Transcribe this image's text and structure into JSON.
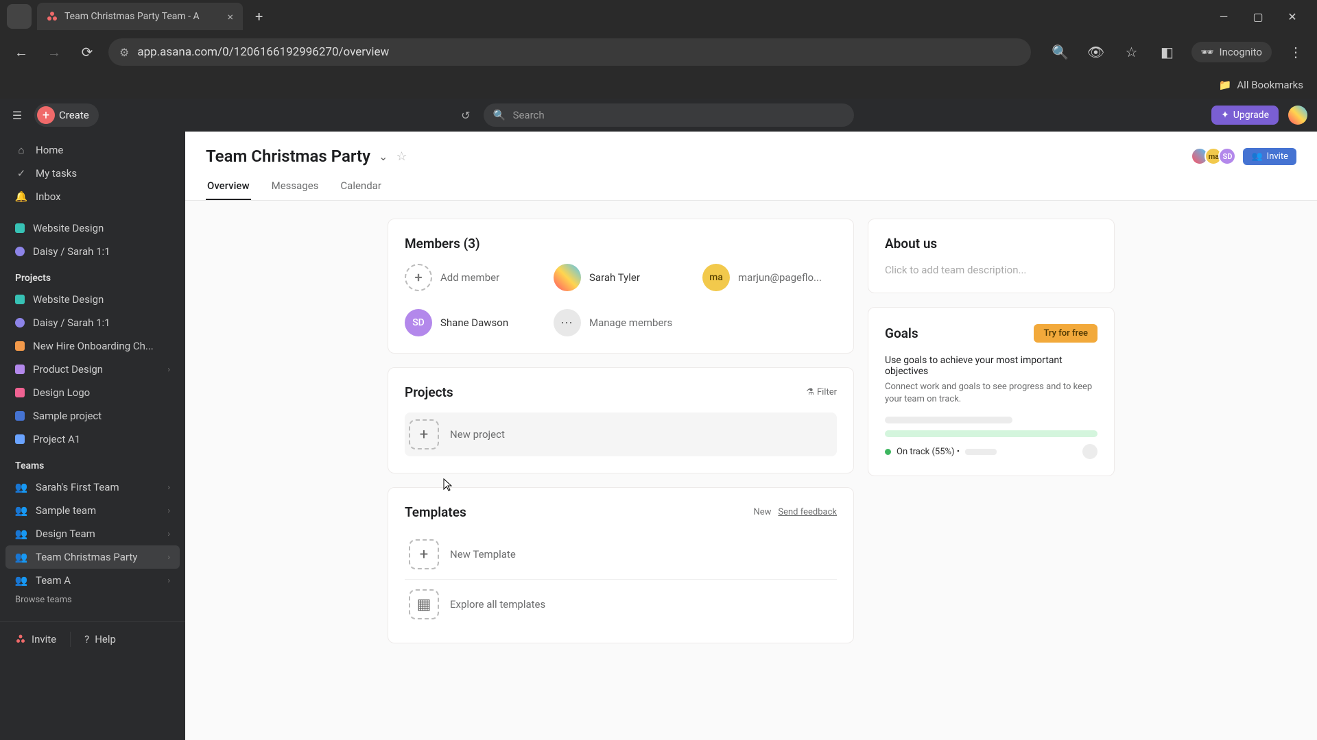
{
  "browser": {
    "tab_title": "Team Christmas Party Team - A",
    "url": "app.asana.com/0/1206166192996270/overview",
    "incognito_label": "Incognito",
    "bookmarks_label": "All Bookmarks"
  },
  "topbar": {
    "create_label": "Create",
    "search_placeholder": "Search",
    "upgrade_label": "Upgrade"
  },
  "sidebar": {
    "nav": [
      {
        "icon": "home",
        "label": "Home"
      },
      {
        "icon": "check",
        "label": "My tasks"
      },
      {
        "icon": "bell",
        "label": "Inbox"
      }
    ],
    "recent": [
      {
        "color": "c-teal",
        "label": "Website Design",
        "shape": "square"
      },
      {
        "color": "c-purple",
        "label": "Daisy / Sarah 1:1",
        "shape": "circle"
      }
    ],
    "projects_label": "Projects",
    "projects": [
      {
        "color": "c-teal",
        "label": "Website Design",
        "shape": "square",
        "chev": false
      },
      {
        "color": "c-purple",
        "label": "Daisy / Sarah 1:1",
        "shape": "circle",
        "chev": false
      },
      {
        "color": "c-orange",
        "label": "New Hire Onboarding Ch...",
        "shape": "square",
        "chev": false
      },
      {
        "color": "c-lav",
        "label": "Product Design",
        "shape": "square",
        "chev": true
      },
      {
        "color": "c-pink",
        "label": "Design Logo",
        "shape": "square",
        "chev": false
      },
      {
        "color": "c-darkblue",
        "label": "Sample project",
        "shape": "square",
        "chev": false
      },
      {
        "color": "c-blue",
        "label": "Project A1",
        "shape": "square",
        "chev": false
      }
    ],
    "teams_label": "Teams",
    "teams": [
      {
        "label": "Sarah's First Team",
        "active": false
      },
      {
        "label": "Sample team",
        "active": false
      },
      {
        "label": "Design Team",
        "active": false
      },
      {
        "label": "Team Christmas Party",
        "active": true
      },
      {
        "label": "Team A",
        "active": false
      }
    ],
    "browse_teams": "Browse teams",
    "invite_label": "Invite",
    "help_label": "Help"
  },
  "header": {
    "title": "Team Christmas Party",
    "tabs": [
      "Overview",
      "Messages",
      "Calendar"
    ],
    "active_tab": "Overview",
    "invite_label": "Invite",
    "avatars": [
      {
        "bg": "linear-gradient(45deg,#ff5263,#4fc3f7)",
        "text": ""
      },
      {
        "bg": "#f2c94c",
        "text": "ma"
      },
      {
        "bg": "#b388eb",
        "text": "SD"
      }
    ]
  },
  "members": {
    "title": "Members (3)",
    "add_label": "Add member",
    "manage_label": "Manage members",
    "items": [
      {
        "name": "Sarah Tyler",
        "avatar_bg": "linear-gradient(45deg,#ff5263,#ffd54f,#4fc3f7)",
        "initials": ""
      },
      {
        "name": "marjun@pageflo...",
        "avatar_bg": "#f2c94c",
        "initials": "ma"
      },
      {
        "name": "Shane Dawson",
        "avatar_bg": "#b388eb",
        "initials": "SD"
      }
    ]
  },
  "projects_card": {
    "title": "Projects",
    "filter_label": "Filter",
    "new_project": "New project"
  },
  "templates_card": {
    "title": "Templates",
    "new_label": "New",
    "feedback_label": "Send feedback",
    "new_template": "New Template",
    "explore": "Explore all templates"
  },
  "about_card": {
    "title": "About us",
    "placeholder": "Click to add team description..."
  },
  "goals_card": {
    "title": "Goals",
    "try_label": "Try for free",
    "desc": "Use goals to achieve your most important objectives",
    "sub": "Connect work and goals to see progress and to keep your team on track.",
    "track_label": "On track (55%) •"
  }
}
